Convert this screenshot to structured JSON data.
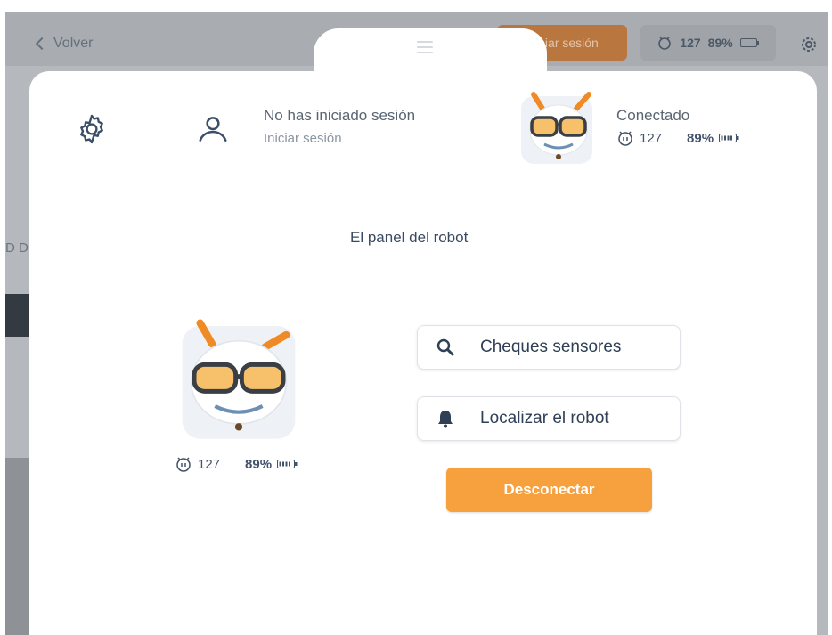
{
  "background": {
    "back_label": "Volver",
    "login_label": "Iniciar sesión",
    "battery_count": "127",
    "battery_percent": "89%",
    "side_text": "D DI"
  },
  "header": {
    "user_title": "No has iniciado sesión",
    "user_action": "Iniciar sesión",
    "connection_label": "Conectado",
    "robot_count": "127",
    "robot_battery": "89%"
  },
  "panel": {
    "title": "El panel del robot",
    "robot_count": "127",
    "robot_battery": "89%",
    "actions": [
      {
        "label": "Cheques sensores",
        "icon": "search-icon"
      },
      {
        "label": "Localizar el robot",
        "icon": "bell-icon"
      }
    ],
    "disconnect_label": "Desconectar"
  },
  "colors": {
    "accent": "#f7a13e",
    "text_primary": "#2f3f55",
    "overlay": "#b5b8bd"
  }
}
